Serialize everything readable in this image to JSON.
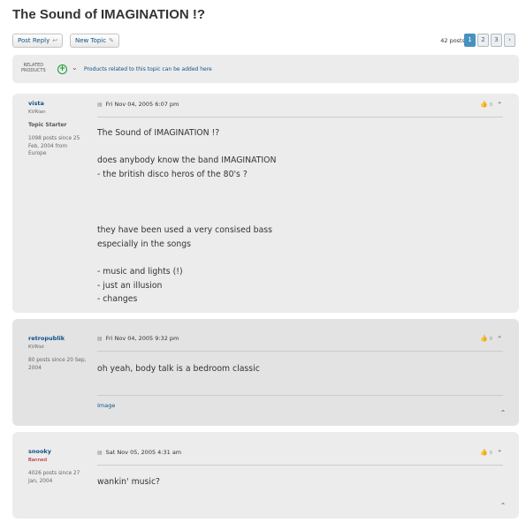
{
  "topic": {
    "title": "The Sound of IMAGINATION !?"
  },
  "toolbar": {
    "post_reply_label": "Post Reply",
    "new_topic_label": "New Topic",
    "posts_count": "42 posts",
    "pages": [
      "1",
      "2",
      "3"
    ],
    "next_label": "›"
  },
  "related": {
    "label_line1": "RELATED",
    "label_line2": "PRODUCTS",
    "text": "Products related to this topic can be added here"
  },
  "posts": [
    {
      "author": "vista",
      "rank": "KVRian",
      "role": "Topic Starter",
      "info": "1098 posts since 25 Feb, 2004 from Europe",
      "date": "Fri Nov 04, 2005 6:07 pm",
      "likes": "0",
      "content": "The Sound of IMAGINATION !?\n\ndoes anybody know the band IMAGINATION\n- the british disco heros of the 80's ?\n\n\n\nthey have been used a very consised bass\nespecially in the songs\n\n- music and lights (!)\n- just an illusion\n- changes"
    },
    {
      "author": "retropublik",
      "rank": "KVRist",
      "info": "80 posts since 20 Sep, 2004",
      "date": "Fri Nov 04, 2005 9:32 pm",
      "likes": "0",
      "content": "oh yeah, body talk is a bedroom classic",
      "signature": "Image"
    },
    {
      "author": "snooky",
      "rank": "Banned",
      "info": "4026 posts since 27 Jan, 2004",
      "date": "Sat Nov 05, 2005 4:31 am",
      "likes": "0",
      "content": "wankin' music?"
    }
  ],
  "colors": {
    "link": "#105289",
    "banned": "#aa0000",
    "active_page": "#4692bf"
  }
}
